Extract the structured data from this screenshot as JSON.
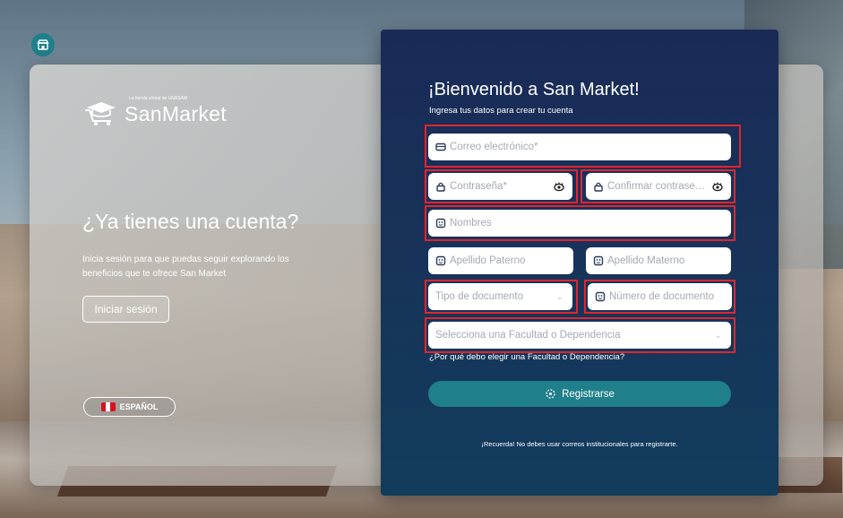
{
  "colors": {
    "accent": "#1f7f8a",
    "panel": "#1a2a57",
    "highlight": "#e0262c"
  },
  "store_button": {
    "icon": "store-icon"
  },
  "brand": {
    "tagline": "La tienda virtual de UNASAM",
    "name": "SanMarket",
    "icon": "shopping-cart-graduation-icon"
  },
  "left": {
    "title": "¿Ya tienes una cuenta?",
    "description": "Inicia sesión para que puedas seguir explorando los beneficios que te ofrece San Market",
    "login_label": "Iniciar sesión",
    "language_label": "ESPAÑOL"
  },
  "form": {
    "title": "¡Bienvenido a San Market!",
    "subtitle": "Ingresa tus datos para crear tu cuenta",
    "email_placeholder": "Correo electrónico*",
    "password_placeholder": "Contraseña*",
    "confirm_placeholder": "Confirmar contraseña*",
    "names_placeholder": "Nombres",
    "paternal_placeholder": "Apellido Paterno",
    "maternal_placeholder": "Apellido Materno",
    "doc_type_placeholder": "Tipo de documento",
    "doc_number_placeholder": "Número de documento",
    "faculty_placeholder": "Selecciona una Facultad o Dependencia",
    "why_faculty": "¿Por qué debo elegir una Facultad o Dependencia?",
    "register_label": "Registrarse",
    "note": "¡Recuerda! No debes usar correos institucionales para registrarte."
  }
}
